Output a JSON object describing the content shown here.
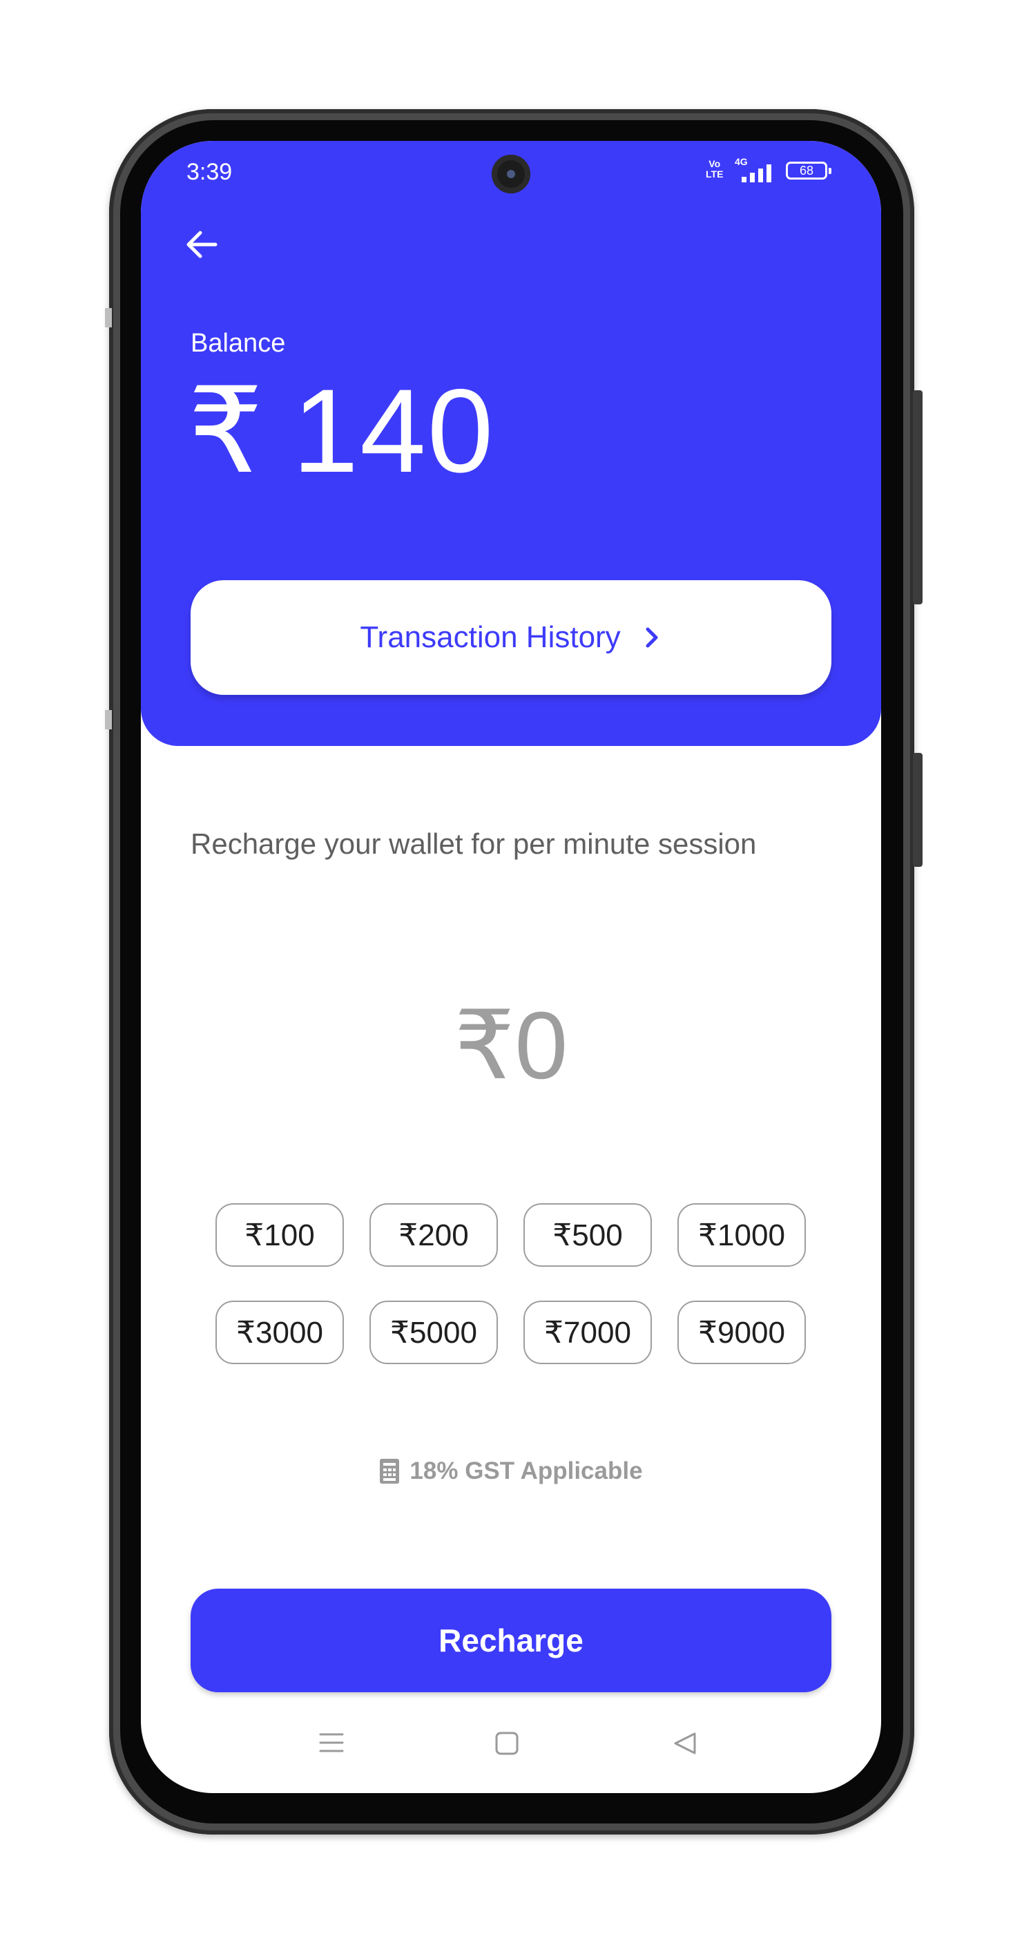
{
  "status_bar": {
    "time": "3:39",
    "volte": "Vo LTE",
    "network": "4G",
    "battery": "68"
  },
  "header": {
    "back_icon": "arrow-left-icon",
    "balance_label": "Balance",
    "currency_symbol": "₹",
    "balance_amount": "140",
    "transaction_history_label": "Transaction History",
    "chevron_icon": "chevron-right-icon",
    "background_color": "#3d3bfa"
  },
  "main": {
    "description": "Recharge your wallet for per minute session",
    "amount_display": "₹0",
    "amount_options": [
      "₹100",
      "₹200",
      "₹500",
      "₹1000",
      "₹3000",
      "₹5000",
      "₹7000",
      "₹9000"
    ],
    "gst_icon": "receipt-icon",
    "gst_note": "18% GST Applicable",
    "recharge_label": "Recharge"
  },
  "nav_bar": {
    "menu_icon": "menu-icon",
    "home_icon": "home-square-icon",
    "back_icon": "back-triangle-icon"
  },
  "colors": {
    "accent": "#3d3bfa",
    "muted_text": "#9e9e9e"
  }
}
